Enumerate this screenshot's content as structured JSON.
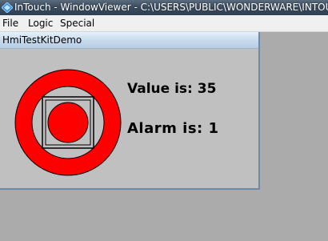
{
  "window": {
    "title": "InTouch - WindowViewer - C:\\USERS\\PUBLIC\\WONDERWARE\\INTOUCH A"
  },
  "menu": {
    "items": [
      "File",
      "Logic",
      "Special"
    ]
  },
  "child_window": {
    "title": "HmiTestKitDemo"
  },
  "display": {
    "value_text": "Value is: 35",
    "alarm_text": "Alarm is: 1"
  },
  "colors": {
    "alarm_red": "#ff0000",
    "panel_gray": "#c0c0c0",
    "desktop_gray": "#ababab"
  },
  "icons": {
    "app": "intouch-app-icon"
  }
}
